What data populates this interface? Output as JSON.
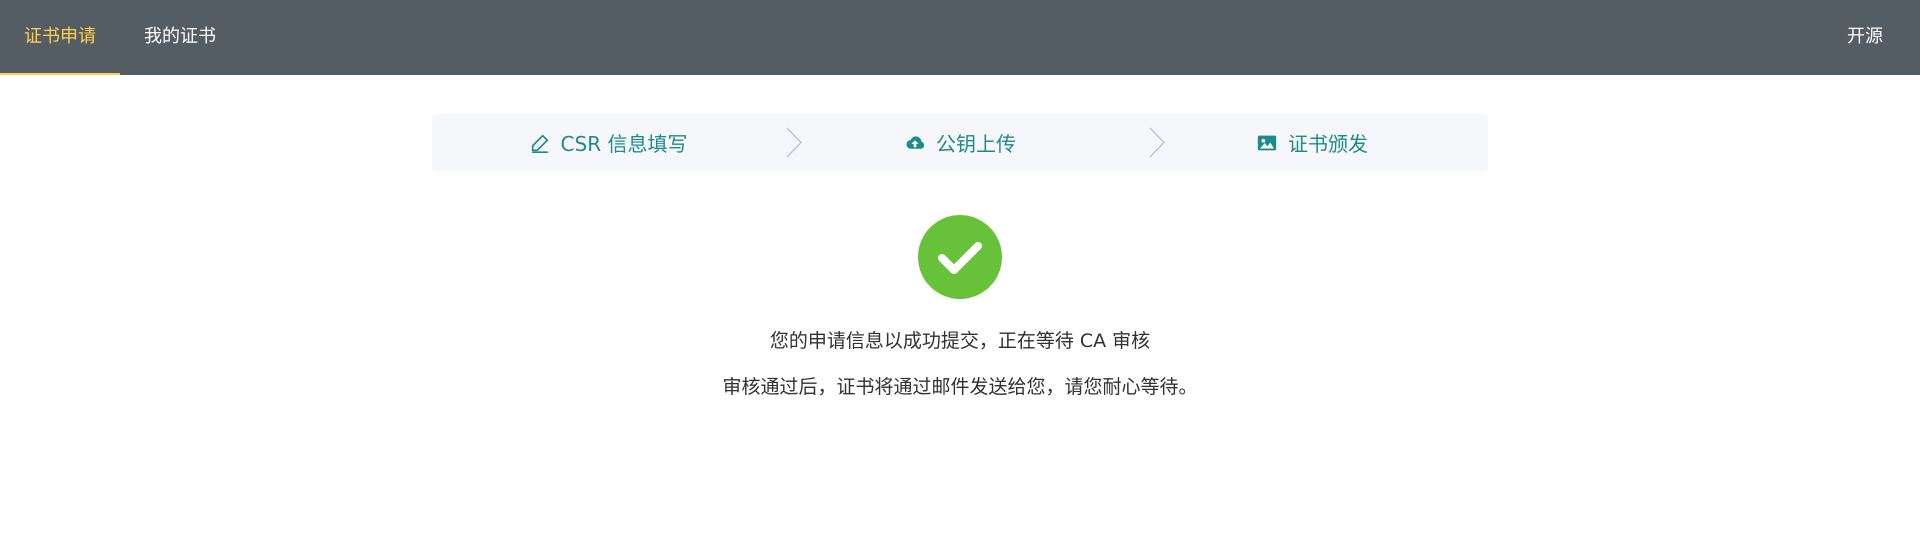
{
  "nav": {
    "items": [
      {
        "label": "证书申请",
        "active": true
      },
      {
        "label": "我的证书",
        "active": false
      }
    ],
    "right": {
      "label": "开源"
    }
  },
  "steps": [
    {
      "label": "CSR 信息填写",
      "icon": "edit-icon"
    },
    {
      "label": "公钥上传",
      "icon": "cloud-upload-icon"
    },
    {
      "label": "证书颁发",
      "icon": "picture-icon"
    }
  ],
  "result": {
    "icon": "success-check-icon",
    "line1": "您的申请信息以成功提交，正在等待 CA 审核",
    "line2": "审核通过后，证书将通过邮件发送给您，请您耐心等待。"
  },
  "colors": {
    "topbar": "#545c64",
    "active_nav": "#ffd04b",
    "step_text": "#1f8a8a",
    "step_bg": "#f5f7fa",
    "success": "#67c23a"
  }
}
